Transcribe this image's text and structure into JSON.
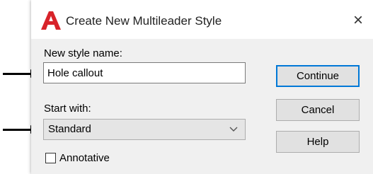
{
  "window": {
    "title": "Create New Multileader Style",
    "close_symbol": "×"
  },
  "form": {
    "name_label": "New style name:",
    "name_value": "Hole callout",
    "start_label": "Start with:",
    "start_value": "Standard",
    "annotative_label": "Annotative",
    "annotative_checked": false
  },
  "buttons": {
    "continue": "Continue",
    "cancel": "Cancel",
    "help": "Help"
  },
  "icons": {
    "app": "autocad-logo-icon",
    "dropdown": "chevron-down-icon",
    "pointer": "arrow-right-icon"
  },
  "colors": {
    "app_icon": "#d8232a",
    "focus_border": "#0078d7"
  }
}
